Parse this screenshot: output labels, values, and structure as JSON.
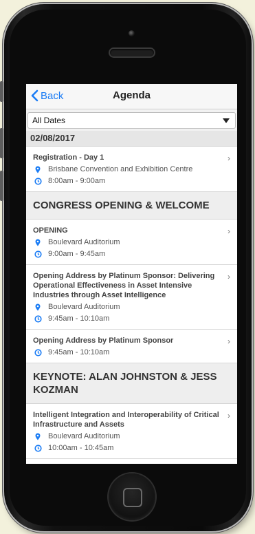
{
  "nav": {
    "back_label": "Back",
    "title": "Agenda"
  },
  "filter": {
    "selected": "All Dates"
  },
  "date_header": "02/08/2017",
  "sessions_a": [
    {
      "title": "Registration - Day 1",
      "location": "Brisbane Convention and Exhibition Centre",
      "time": "8:00am - 9:00am"
    }
  ],
  "section_1": "CONGRESS OPENING & WELCOME",
  "sessions_b": [
    {
      "title": "OPENING",
      "location": "Boulevard Auditorium",
      "time": "9:00am - 9:45am"
    },
    {
      "title": "Opening Address by Platinum Sponsor: Delivering Operational Effectiveness in Asset Intensive Industries through Asset Intelligence",
      "location": "Boulevard Auditorium",
      "time": "9:45am - 10:10am"
    },
    {
      "title": "Opening Address by Platinum Sponsor",
      "time": "9:45am - 10:10am"
    }
  ],
  "section_2": "KEYNOTE: ALAN JOHNSTON & JESS KOZMAN",
  "sessions_c": [
    {
      "title": "Intelligent Integration and Interoperability of Critical Infrastructure and Assets",
      "location": "Boulevard Auditorium",
      "time": "10:00am - 10:45am"
    }
  ],
  "colors": {
    "accent": "#1a7cf5",
    "background": "#f3f1dc"
  },
  "icons": {
    "location": "map-pin-icon",
    "time": "clock-icon",
    "chevron": "chevron-right-icon",
    "back": "chevron-left-icon"
  }
}
